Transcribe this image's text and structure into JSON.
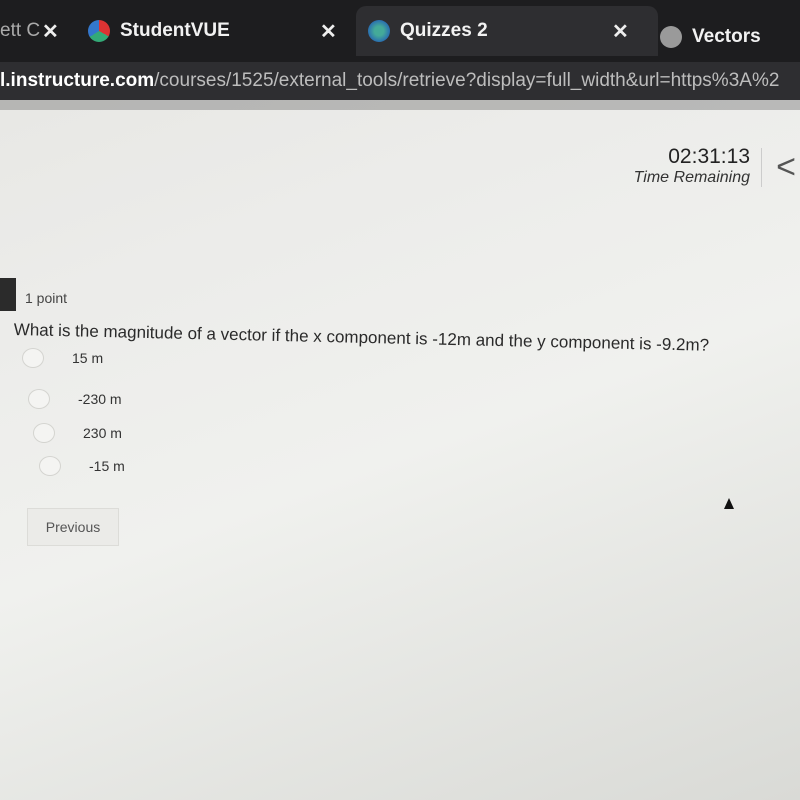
{
  "browser": {
    "tabs": [
      {
        "label": "ett C",
        "icon": "canvas-icon",
        "active": false
      },
      {
        "label": "StudentVUE",
        "icon": "studentvue-icon",
        "active": false
      },
      {
        "label": "Quizzes 2",
        "icon": "globe-icon",
        "active": true
      },
      {
        "label": "Vectors",
        "icon": "globe-icon",
        "active": false
      }
    ],
    "url_domain": "l.instructure.com",
    "url_path": "/courses/1525/external_tools/retrieve?display=full_width&url=https%3A%2"
  },
  "timer": {
    "value": "02:31:13",
    "label": "Time Remaining"
  },
  "question": {
    "points": "1 point",
    "text": "What is the magnitude of a vector if the x component is -12m and the y component is -9.2m?",
    "options": [
      "15 m",
      "-230 m",
      "230 m",
      "-15 m"
    ]
  },
  "nav": {
    "previous_label": "Previous"
  }
}
